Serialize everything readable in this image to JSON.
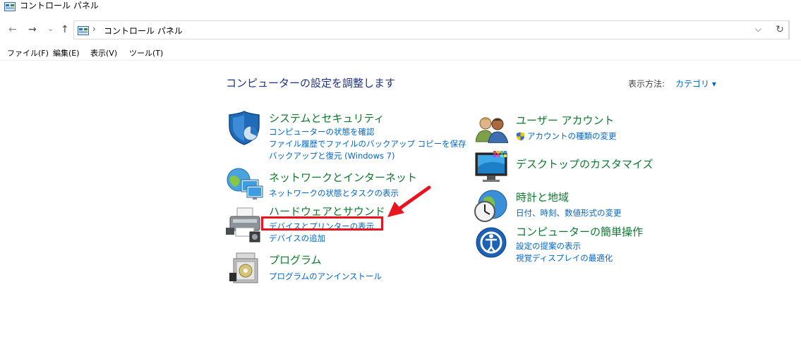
{
  "window": {
    "title": "コントロール パネル"
  },
  "address": {
    "breadcrumb": "コントロール パネル",
    "sep": "›",
    "dropdown": "⌵",
    "refresh": "↻"
  },
  "nav": {
    "back": "←",
    "forward": "→",
    "recent": "⌄",
    "up": "↑"
  },
  "menu": {
    "file": "ファイル(F)",
    "edit": "編集(E)",
    "view": "表示(V)",
    "tools": "ツール(T)"
  },
  "main": {
    "heading": "コンピューターの設定を調整します",
    "view_by_label": "表示方法:",
    "view_by_value": "カテゴリ ▾"
  },
  "categories_left": [
    {
      "title": "システムとセキュリティ",
      "links": [
        "コンピューターの状態を確認",
        "ファイル履歴でファイルのバックアップ コピーを保存",
        "バックアップと復元 (Windows 7)"
      ],
      "icon": "shield-icon"
    },
    {
      "title": "ネットワークとインターネット",
      "links": [
        "ネットワークの状態とタスクの表示"
      ],
      "icon": "network-globe-icon"
    },
    {
      "title": "ハードウェアとサウンド",
      "links": [
        "デバイスとプリンターの表示",
        "デバイスの追加"
      ],
      "icon": "printer-icon"
    },
    {
      "title": "プログラム",
      "links": [
        "プログラムのアンインストール"
      ],
      "icon": "programs-icon"
    }
  ],
  "categories_right": [
    {
      "title": "ユーザー アカウント",
      "links": [
        "アカウントの種類の変更"
      ],
      "icon": "users-icon"
    },
    {
      "title": "デスクトップのカスタマイズ",
      "links": [],
      "icon": "monitor-icon"
    },
    {
      "title": "時計と地域",
      "links": [
        "日付、時刻、数値形式の変更"
      ],
      "icon": "clock-globe-icon"
    },
    {
      "title": "コンピューターの簡単操作",
      "links": [
        "設定の提案の表示",
        "視覚ディスプレイの最適化"
      ],
      "icon": "ease-of-access-icon"
    }
  ],
  "colors": {
    "heading": "#1e3287",
    "category_title": "#0c7a2b",
    "link": "#0066cc",
    "annotation": "#e8141e"
  }
}
